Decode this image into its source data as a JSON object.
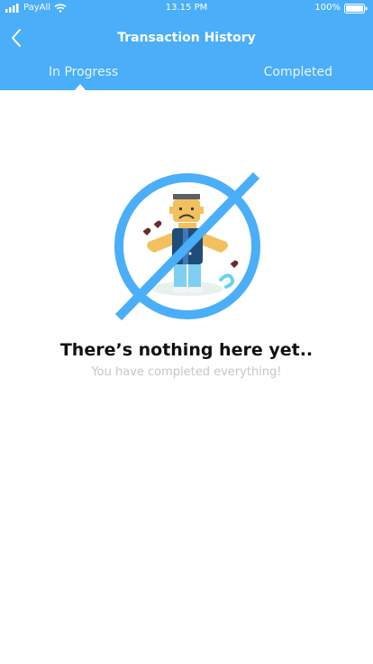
{
  "status_bar": {
    "carrier": "PayAll",
    "time": "13.15 PM",
    "battery": "100%",
    "icons": [
      "signal-icon",
      "wifi-icon",
      "battery-icon"
    ]
  },
  "header": {
    "title": "Transaction History",
    "back_icon": "chevron-left-icon",
    "background_color": "#4aaef8"
  },
  "tabs": [
    {
      "label": "In Progress",
      "active": true
    },
    {
      "label": "Completed",
      "active": false
    }
  ],
  "empty_state": {
    "title": "There’s nothing here yet..",
    "subtitle": "You have completed everything!",
    "illustration": "empty-state-person-icon"
  }
}
